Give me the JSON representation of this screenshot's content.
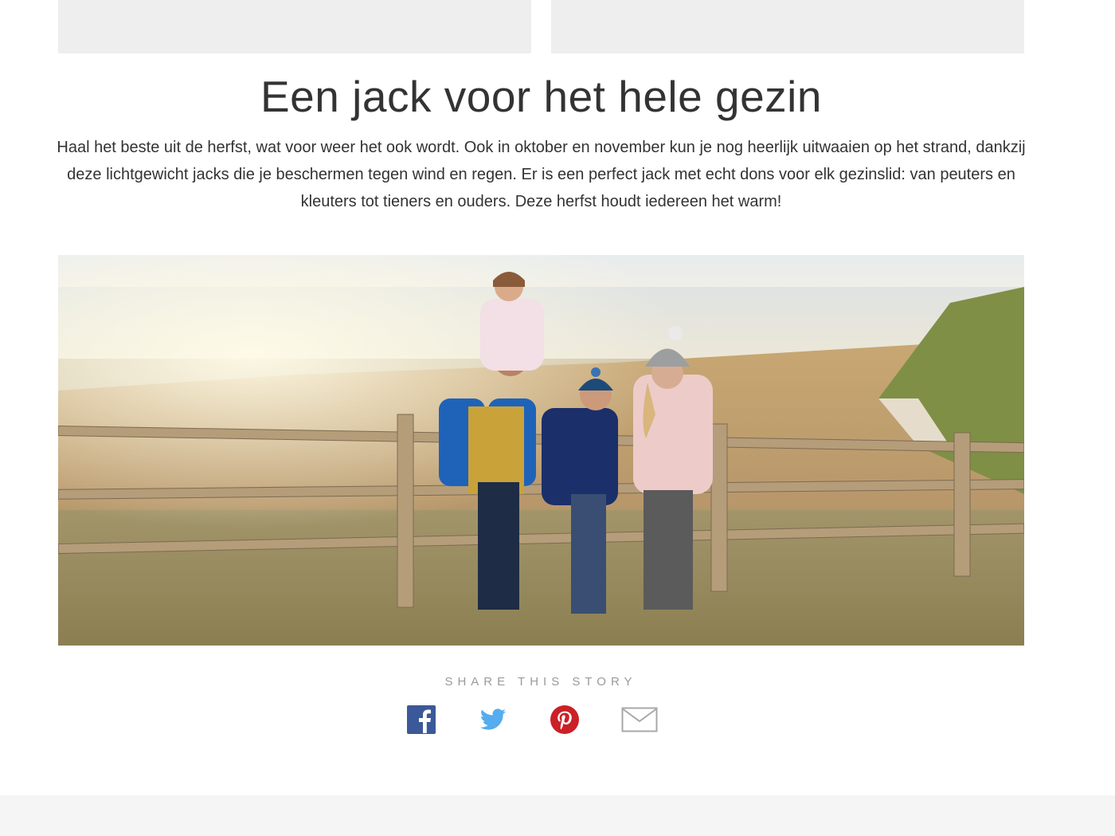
{
  "article": {
    "title": "Een jack voor het hele gezin",
    "intro": "Haal het beste uit de herfst, wat voor weer het ook wordt. Ook in oktober en november kun je nog heerlijk uitwaaien op het strand, dankzij deze lichtgewicht jacks die je beschermen tegen wind en regen. Er is een perfect jack met echt dons voor elk gezinslid: van peuters en kleuters tot tieners en ouders. Deze herfst houdt iedereen het warm!"
  },
  "share": {
    "label": "SHARE THIS STORY",
    "icons": [
      {
        "name": "facebook-icon",
        "color": "#3b5998"
      },
      {
        "name": "twitter-icon",
        "color": "#55acee"
      },
      {
        "name": "pinterest-icon",
        "color": "#cb2027"
      },
      {
        "name": "email-icon",
        "color": "#a8a8a8"
      }
    ]
  },
  "colors": {
    "text": "#333333",
    "muted": "#9a9a9a",
    "placeholder": "#eeeeee",
    "footer": "#f5f5f5"
  }
}
